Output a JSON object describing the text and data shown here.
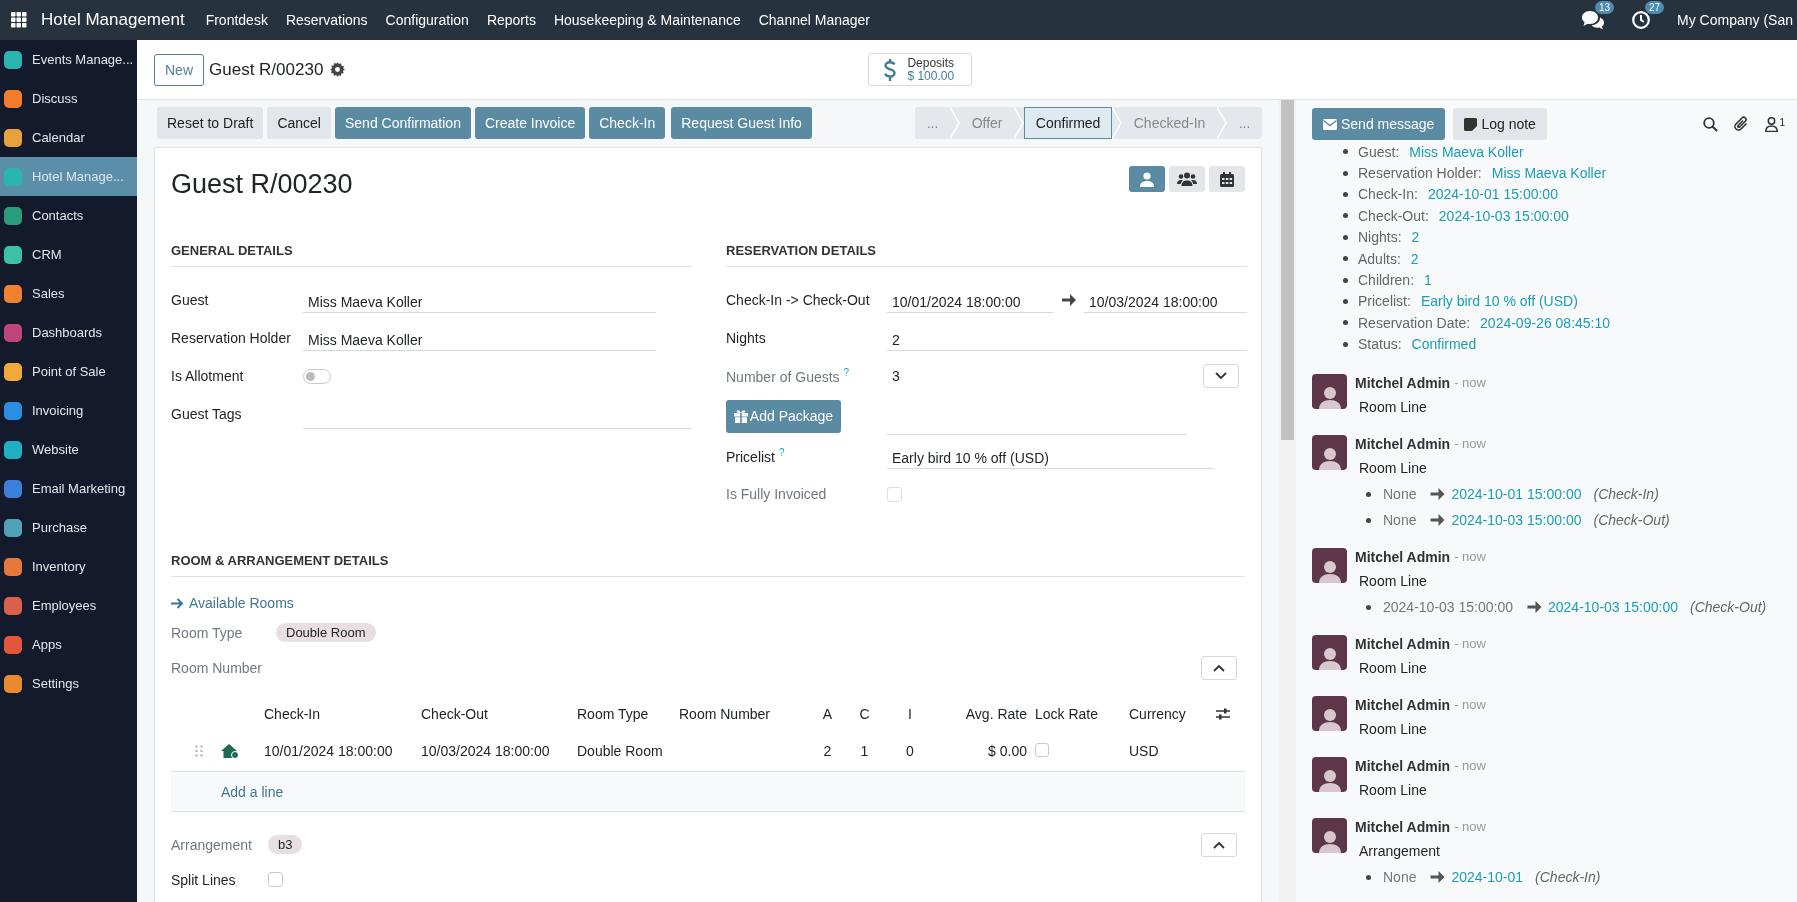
{
  "topbar": {
    "app_name": "Hotel Management",
    "menus": [
      "Frontdesk",
      "Reservations",
      "Configuration",
      "Reports",
      "Housekeeping & Maintenance",
      "Channel Manager"
    ],
    "messages_badge": "13",
    "activities_badge": "27",
    "company": "My Company (San"
  },
  "sidebar": {
    "items": [
      {
        "label": "Events Manage...",
        "selected": false,
        "color": "#2bb5b0"
      },
      {
        "label": "Discuss",
        "selected": false,
        "color": "#f57c2b"
      },
      {
        "label": "Calendar",
        "selected": false,
        "color": "#e9a23b"
      },
      {
        "label": "Hotel Manage...",
        "selected": true,
        "color": "#2bb5b0"
      },
      {
        "label": "Contacts",
        "selected": false,
        "color": "#2a9d7c"
      },
      {
        "label": "CRM",
        "selected": false,
        "color": "#3cc0a8"
      },
      {
        "label": "Sales",
        "selected": false,
        "color": "#f0812f"
      },
      {
        "label": "Dashboards",
        "selected": false,
        "color": "#c0457a"
      },
      {
        "label": "Point of Sale",
        "selected": false,
        "color": "#f2a93b"
      },
      {
        "label": "Invoicing",
        "selected": false,
        "color": "#2a8fe0"
      },
      {
        "label": "Website",
        "selected": false,
        "color": "#1fb0c8"
      },
      {
        "label": "Email Marketing",
        "selected": false,
        "color": "#3a7fd8"
      },
      {
        "label": "Purchase",
        "selected": false,
        "color": "#4fa3b5"
      },
      {
        "label": "Inventory",
        "selected": false,
        "color": "#e8773a"
      },
      {
        "label": "Employees",
        "selected": false,
        "color": "#d9604b"
      },
      {
        "label": "Apps",
        "selected": false,
        "color": "#e2573b"
      },
      {
        "label": "Settings",
        "selected": false,
        "color": "#ea8a2f"
      }
    ]
  },
  "control_panel": {
    "new_button": "New",
    "breadcrumb": "Guest R/00230",
    "smart_button": {
      "label": "Deposits",
      "value": "$ 100.00"
    }
  },
  "actions": [
    {
      "label": "Reset to Draft",
      "kind": "secondary"
    },
    {
      "label": "Cancel",
      "kind": "secondary"
    },
    {
      "label": "Send Confirmation",
      "kind": "primary"
    },
    {
      "label": "Create Invoice",
      "kind": "primary"
    },
    {
      "label": "Check-In",
      "kind": "primary"
    },
    {
      "label": "Request Guest Info",
      "kind": "primary"
    }
  ],
  "statusbar": [
    {
      "label": "...",
      "selected": false
    },
    {
      "label": "Offer",
      "selected": false
    },
    {
      "label": "Confirmed",
      "selected": true
    },
    {
      "label": "Checked-In",
      "selected": false
    },
    {
      "label": "...",
      "selected": false
    }
  ],
  "form": {
    "title": "Guest R/00230",
    "view_buttons": [
      {
        "kind": "person",
        "selected": true
      },
      {
        "kind": "people",
        "selected": false
      },
      {
        "kind": "calendar",
        "selected": false
      }
    ],
    "general": {
      "title": "GENERAL DETAILS",
      "fields": [
        {
          "kind": "text",
          "label": "Guest",
          "value": "Miss Maeva Koller"
        },
        {
          "kind": "text",
          "label": "Reservation Holder",
          "value": "Miss Maeva Koller"
        },
        {
          "kind": "toggle",
          "label": "Is Allotment",
          "on": false
        },
        {
          "kind": "tags",
          "label": "Guest Tags"
        }
      ]
    },
    "reservation": {
      "title": "RESERVATION DETAILS",
      "dates": {
        "label": "Check-In -> Check-Out",
        "start": "10/01/2024 18:00:00",
        "end": "10/03/2024 18:00:00"
      },
      "nights": {
        "label": "Nights",
        "value": "2"
      },
      "guests": {
        "label": "Number of Guests",
        "help": "?",
        "value": "3",
        "expanded": false,
        "readonly": true
      },
      "add_package": "Add Package",
      "pricelist": {
        "label": "Pricelist",
        "help": "?",
        "value": "Early bird 10 % off (USD)"
      },
      "fully_invoiced": {
        "label": "Is Fully Invoiced",
        "checked": false,
        "readonly": true
      }
    },
    "rooms": {
      "title": "ROOM & ARRANGEMENT DETAILS",
      "link": "Available Rooms",
      "room_type": {
        "label": "Room Type",
        "tag": "Double Room"
      },
      "room_number": {
        "label": "Room Number",
        "expanded": true
      },
      "table": {
        "columns": [
          "Check-In",
          "Check-Out",
          "Room Type",
          "Room Number",
          "A",
          "C",
          "I",
          "Avg. Rate",
          "Lock Rate",
          "Currency"
        ],
        "rows": [
          {
            "check_in": "10/01/2024 18:00:00",
            "check_out": "10/03/2024 18:00:00",
            "room_type": "Double Room",
            "adults": "2",
            "children": "1",
            "infants": "0",
            "avg_rate": "$ 0.00",
            "lock_rate": false,
            "currency": "USD"
          }
        ],
        "add_line": "Add a line"
      },
      "arrangement": {
        "label": "Arrangement",
        "tag": "b3",
        "expanded": true
      },
      "split_lines": {
        "label": "Split Lines",
        "checked": false
      }
    }
  },
  "chatter": {
    "send_message": "Send message",
    "log_note": "Log note",
    "followers": "1",
    "tracking": [
      {
        "label": "Guest:",
        "value": "Miss Maeva Koller"
      },
      {
        "label": "Reservation Holder:",
        "value": "Miss Maeva Koller"
      },
      {
        "label": "Check-In:",
        "value": "2024-10-01 15:00:00"
      },
      {
        "label": "Check-Out:",
        "value": "2024-10-03 15:00:00"
      },
      {
        "label": "Nights:",
        "value": "2"
      },
      {
        "label": "Adults:",
        "value": "2"
      },
      {
        "label": "Children:",
        "value": "1"
      },
      {
        "label": "Pricelist:",
        "value": "Early bird 10 % off (USD)"
      },
      {
        "label": "Reservation Date:",
        "value": "2024-09-26 08:45:10"
      },
      {
        "label": "Status:",
        "value": "Confirmed"
      }
    ],
    "messages": [
      {
        "author": "Mitchel Admin",
        "time": "- now",
        "body": "Room Line"
      },
      {
        "author": "Mitchel Admin",
        "time": "- now",
        "body": "Room Line",
        "changes": [
          {
            "old": "None",
            "new": "2024-10-01 15:00:00",
            "field": "(Check-In)"
          },
          {
            "old": "None",
            "new": "2024-10-03 15:00:00",
            "field": "(Check-Out)"
          }
        ]
      },
      {
        "author": "Mitchel Admin",
        "time": "- now",
        "body": "Room Line",
        "changes": [
          {
            "old": "2024-10-03 15:00:00",
            "new": "2024-10-03 15:00:00",
            "field": "(Check-Out)"
          }
        ]
      },
      {
        "author": "Mitchel Admin",
        "time": "- now",
        "body": "Room Line"
      },
      {
        "author": "Mitchel Admin",
        "time": "- now",
        "body": "Room Line"
      },
      {
        "author": "Mitchel Admin",
        "time": "- now",
        "body": "Room Line"
      },
      {
        "author": "Mitchel Admin",
        "time": "- now",
        "body": "Arrangement",
        "changes": [
          {
            "old": "None",
            "new": "2024-10-01",
            "field": "(Check-In)"
          }
        ]
      }
    ]
  }
}
